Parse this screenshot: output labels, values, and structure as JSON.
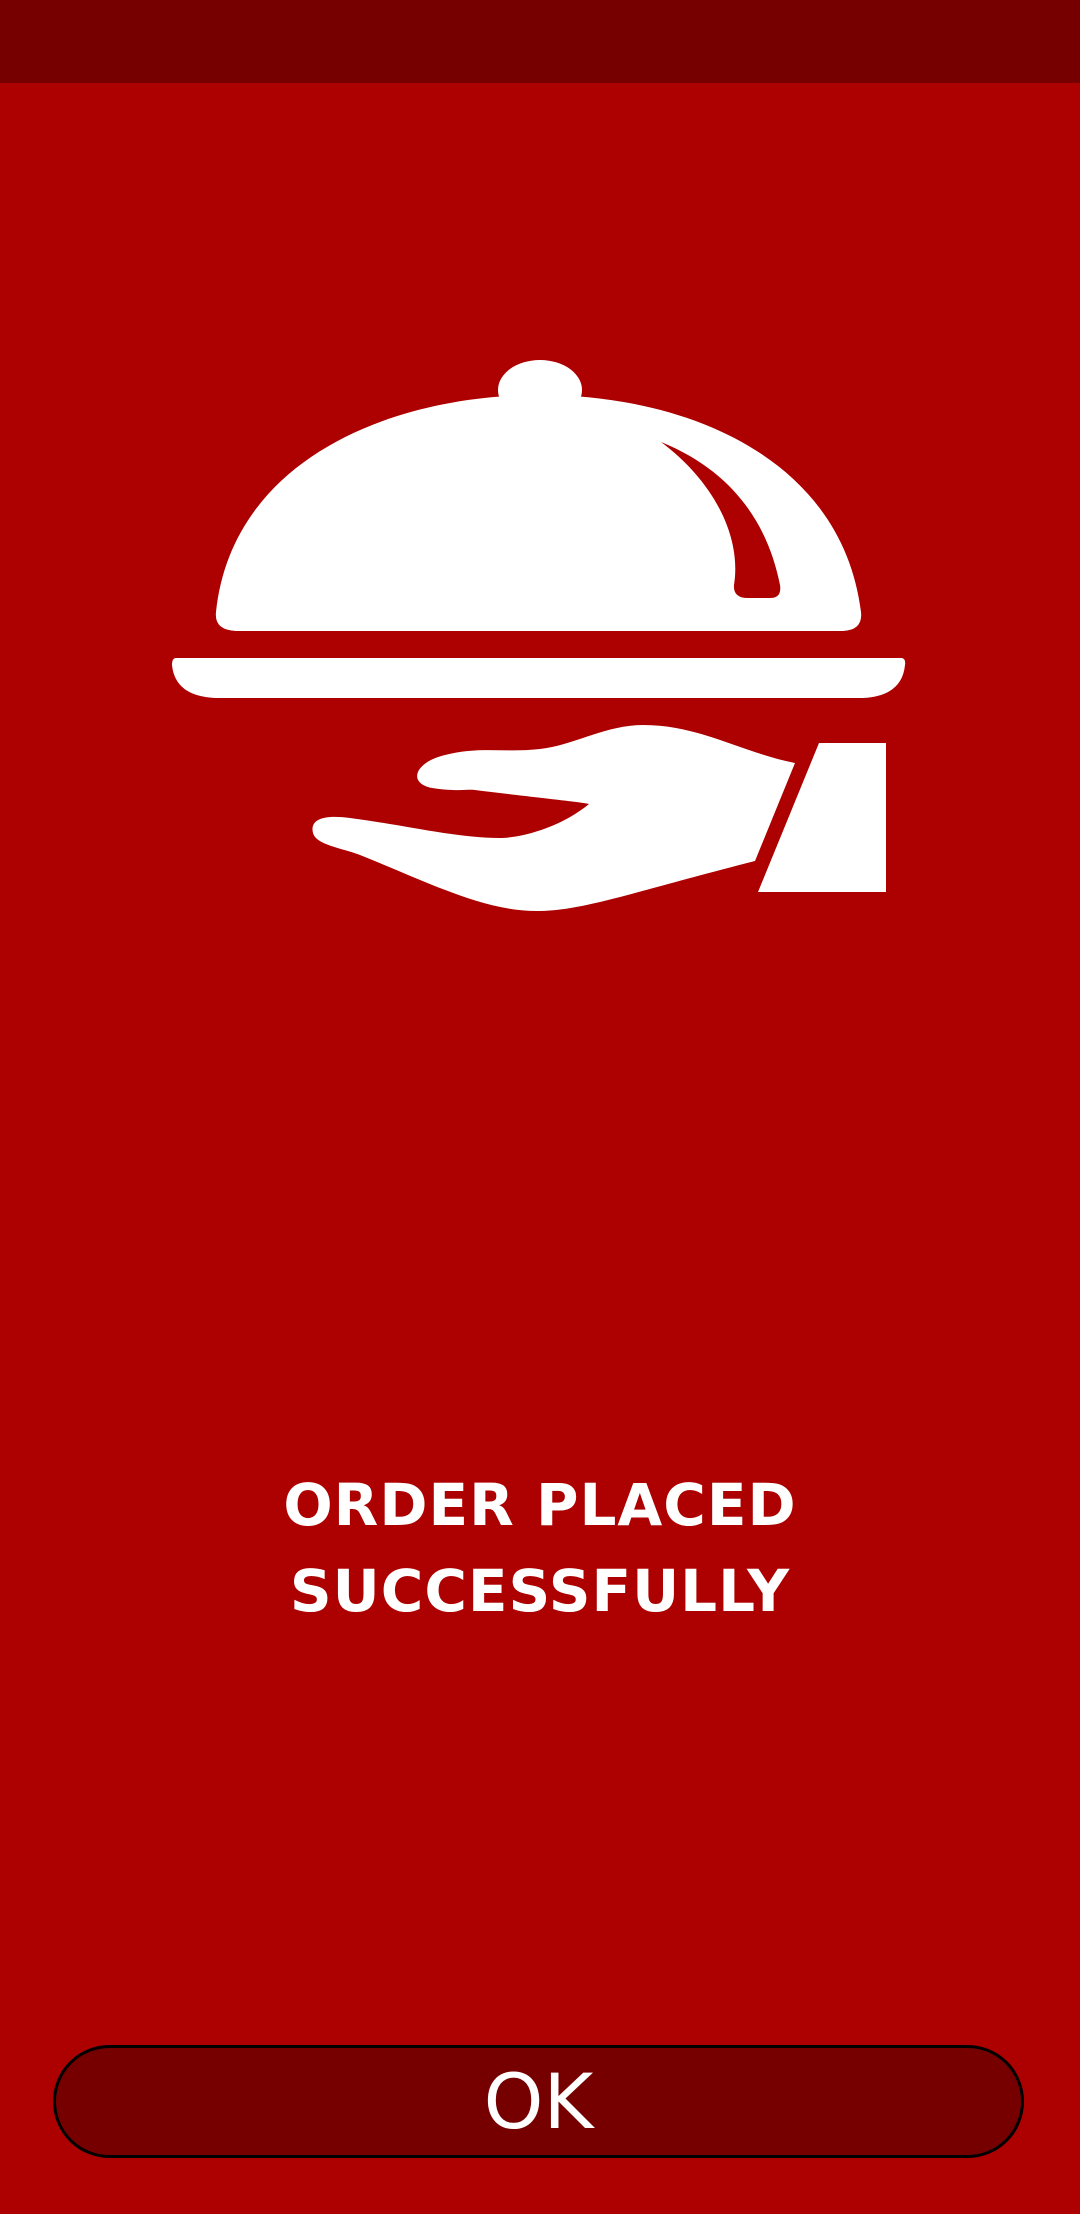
{
  "colors": {
    "background": "#ad0000",
    "status_bar": "#760000",
    "button_fill": "#760000",
    "button_border": "#000000",
    "text": "#ffffff"
  },
  "illustration": {
    "icon": "serving-cloche-on-hand-icon"
  },
  "message": {
    "line1": "ORDER PLACED",
    "line2": "SUCCESSFULLY"
  },
  "ok_button": {
    "label": "OK"
  }
}
